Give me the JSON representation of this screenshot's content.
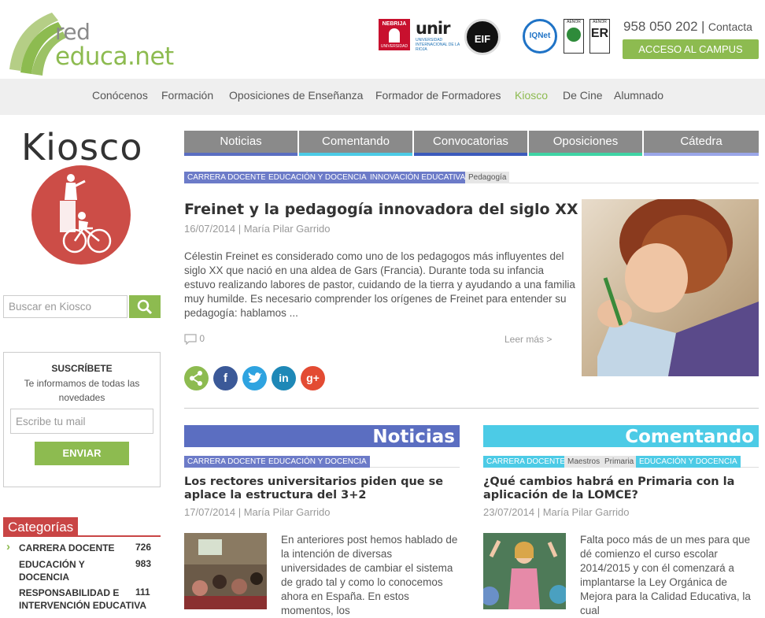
{
  "header": {
    "logo_line1": "red",
    "logo_line2": "educa.net",
    "partners": {
      "nebrija_top": "NEBRIJA",
      "nebrija_bottom": "UNIVERSIDAD",
      "unir": "unir",
      "unir_sub": "UNIVERSIDAD INTERNACIONAL DE LA RIOJA",
      "eif": "EIF",
      "iqnet": "IQNet",
      "aenor1": "AENOR",
      "aenor2": "AENOR",
      "er": "ER"
    },
    "phone": "958 050 202",
    "separator": "|",
    "contact": "Contacta",
    "campus_button": "ACCESO AL CAMPUS"
  },
  "nav": {
    "items": [
      "Conócenos",
      "Formación",
      "Oposiciones de Enseñanza",
      "Formador de Formadores",
      "Kiosco",
      "De Cine",
      "Alumnado"
    ],
    "active": "Kiosco"
  },
  "sidebar": {
    "title": "Kiosco",
    "search_placeholder": "Buscar en Kiosco",
    "subscribe": {
      "title": "SUSCRÍBETE",
      "text": "Te informamos de todas las novedades",
      "email_placeholder": "Escribe tu mail",
      "button": "ENVIAR"
    },
    "categories_title": "Categorías",
    "categories": [
      {
        "label": "CARRERA DOCENTE",
        "count": "726",
        "arrow": "›"
      },
      {
        "label": "EDUCACIÓN Y DOCENCIA",
        "count": "983"
      },
      {
        "label": "RESPONSABILIDAD E INTERVENCIÓN EDUCATIVA",
        "count": "111"
      }
    ]
  },
  "tabs": [
    "Noticias",
    "Comentando",
    "Convocatorias",
    "Oposiciones",
    "Cátedra"
  ],
  "colors": {
    "green": "#8dbb50",
    "noticias": "#5b6ec1",
    "comentando": "#4ccbe6",
    "convocatorias": "#3c5bbc",
    "oposiciones": "#3fd4a4",
    "catedra": "#9aa6e8",
    "categorias_red": "#c94545"
  },
  "featured": {
    "tags": [
      "CARRERA DOCENTE",
      "EDUCACIÓN Y DOCENCIA",
      "INNOVACIÓN EDUCATIVA",
      "Pedagogía"
    ],
    "title": "Freinet y la pedagogía innovadora del siglo XX",
    "date": "16/07/2014",
    "author": "María Pilar Garrido",
    "excerpt": "Célestin Freinet es considerado como uno de los pedagogos más influyentes del siglo XX que nació en una aldea de Gars (Francia). Durante toda su infancia estuvo realizando labores de pastor, cuidando de la tierra y ayudando a una familia muy humilde. Es necesario comprender los orígenes de Freinet para entender su pedagogía: hablamos ...",
    "comments": "0",
    "read_more": "Leer más >",
    "social": [
      "share",
      "f",
      "t",
      "in",
      "g+"
    ]
  },
  "noticias": {
    "header": "Noticias",
    "tags": [
      "CARRERA DOCENTE",
      "EDUCACIÓN Y DOCENCIA"
    ],
    "title": "Los rectores universitarios piden que se aplace la estructura del 3+2",
    "date": "17/07/2014",
    "author": "María Pilar Garrido",
    "excerpt": "En anteriores post hemos hablado de la intención de diversas universidades de cambiar el sistema de grado tal y como lo conocemos ahora en España. En estos momentos, los"
  },
  "comentando": {
    "header": "Comentando",
    "tags": [
      "CARRERA DOCENTE",
      "Maestros",
      "Primaria",
      "EDUCACIÓN Y DOCENCIA"
    ],
    "title": "¿Qué cambios habrá en Primaria con la aplicación de la LOMCE?",
    "date": "23/07/2014",
    "author": "María Pilar Garrido",
    "excerpt": "Falta poco más de un mes para que dé comienzo el curso escolar 2014/2015 y con él comenzará a implantarse la Ley Orgánica de Mejora para la Calidad Educativa, la cual"
  }
}
